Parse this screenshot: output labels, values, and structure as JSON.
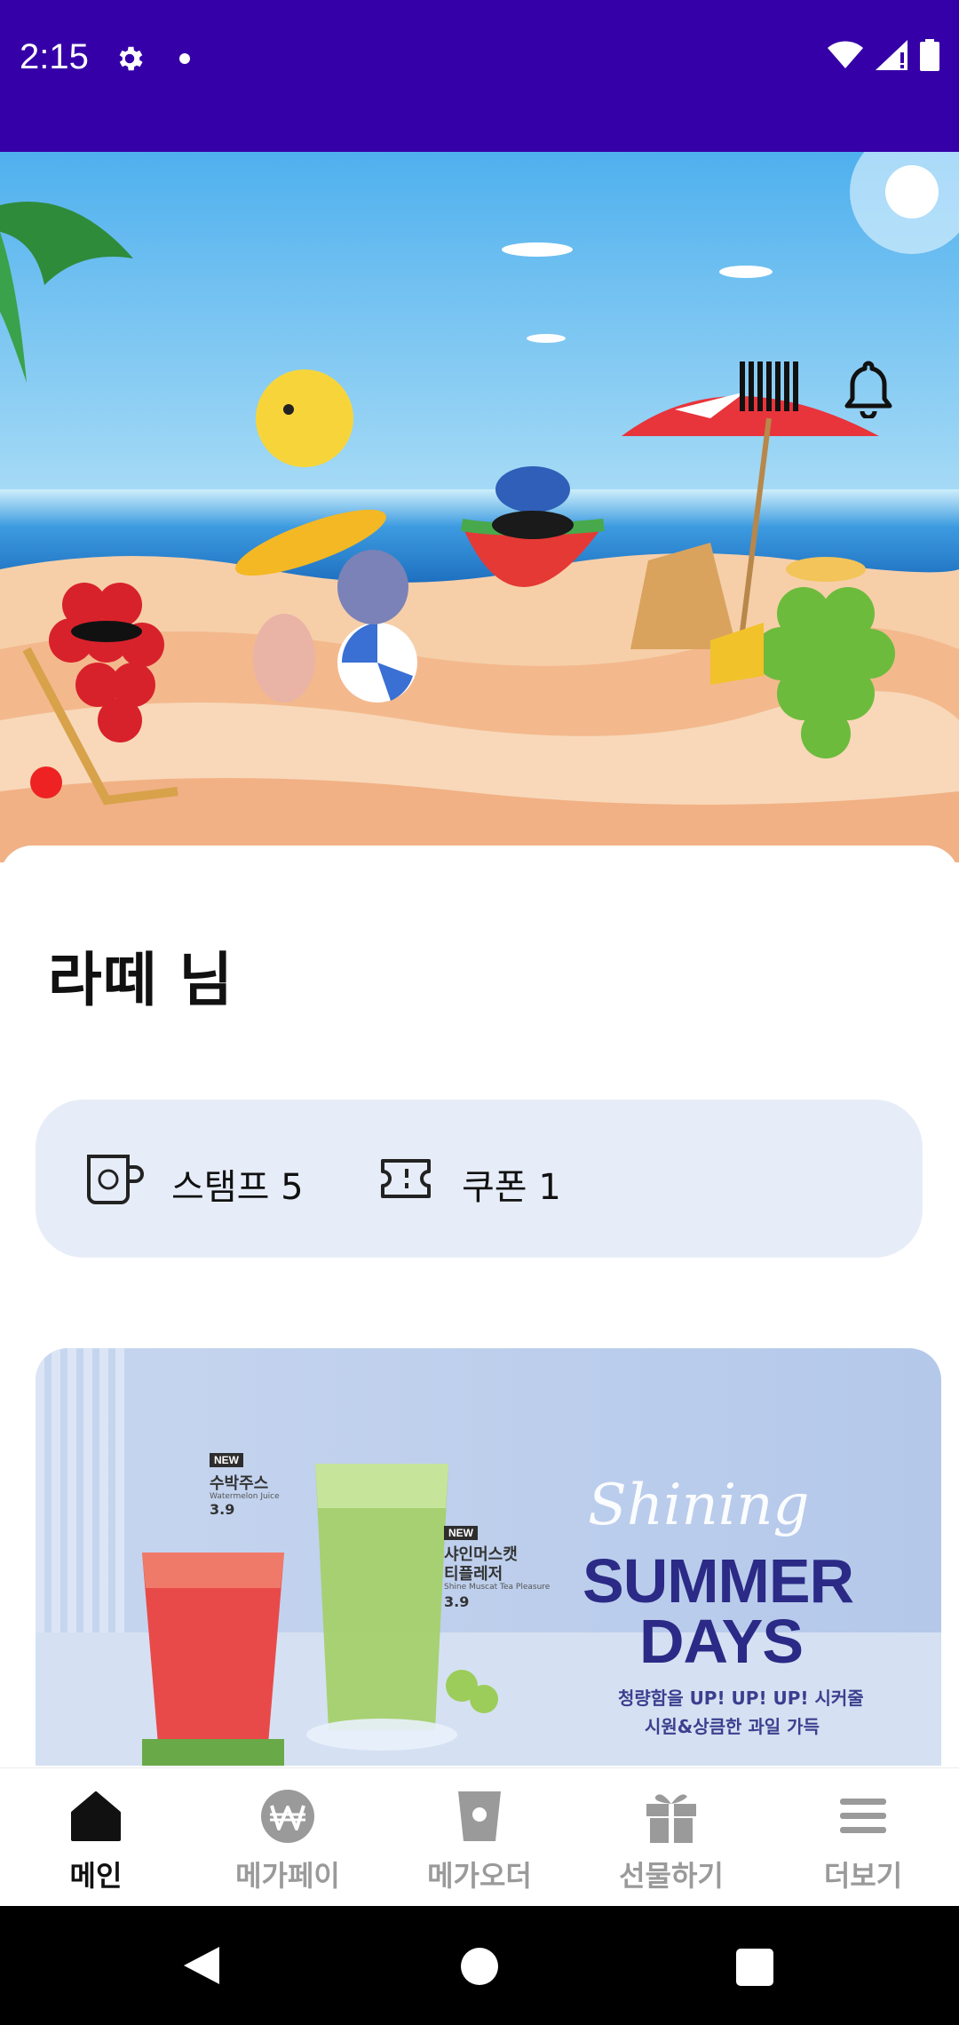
{
  "status_bar": {
    "time": "2:15",
    "background": "#3600a8"
  },
  "hero": {
    "sky_color": "#5ab8ef",
    "sea_color": "#1f7fd0",
    "sand_color": "#f6cfa9",
    "icons": [
      "barcode-icon",
      "bell-icon"
    ]
  },
  "greeting": "라떼 님",
  "rewards": {
    "stamp_label": "스탬프 5",
    "coupon_label": "쿠폰 1"
  },
  "promo": {
    "item1_tag": "NEW",
    "item1_name": "수박주스",
    "item1_sub": "Watermelon Juice",
    "item1_price": "3.9",
    "item2_tag": "NEW",
    "item2_name_line1": "샤인머스캣",
    "item2_name_line2": "티플레저",
    "item2_sub": "Shine Muscat Tea Pleasure",
    "item2_price": "3.9",
    "script_title": "Shining",
    "title_line1": "SUMMER",
    "title_line2": "DAYS",
    "tagline1": "청량함을 UP! UP! UP! 시커줄",
    "tagline2": "시원&상큼한 과일 가득"
  },
  "bottom_nav": {
    "items": [
      {
        "label": "메인",
        "icon": "home-icon",
        "active": true
      },
      {
        "label": "메가페이",
        "icon": "won-icon",
        "active": false
      },
      {
        "label": "메가오더",
        "icon": "cup-order-icon",
        "active": false
      },
      {
        "label": "선물하기",
        "icon": "gift-icon",
        "active": false
      },
      {
        "label": "더보기",
        "icon": "menu-icon",
        "active": false
      }
    ]
  },
  "colors": {
    "accent": "#3600a8",
    "card_bg": "#e7edf8",
    "nav_inactive": "#9a9a9a",
    "nav_active": "#111111"
  }
}
